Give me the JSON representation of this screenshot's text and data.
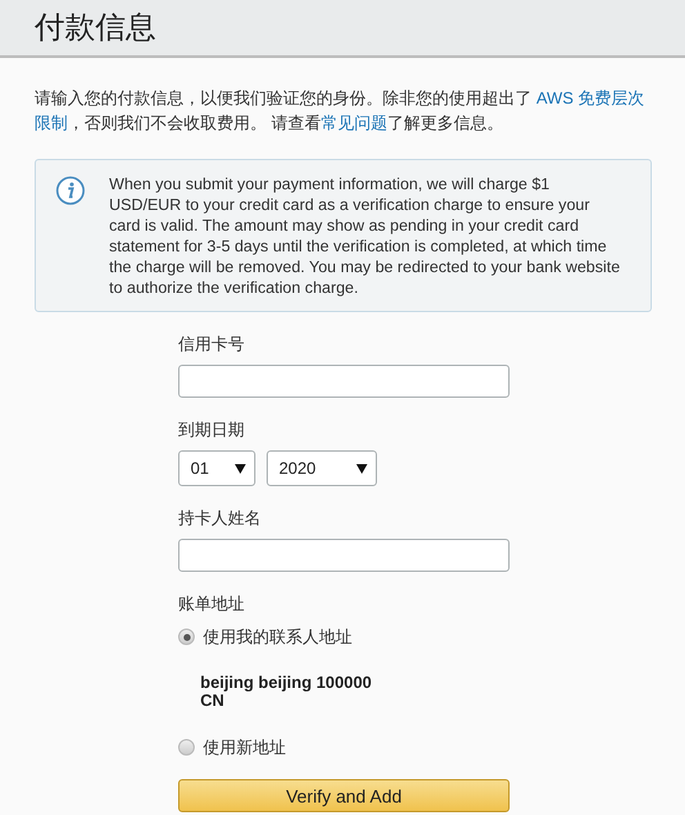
{
  "header": {
    "title": "付款信息"
  },
  "intro": [
    {
      "kind": "text",
      "text": "请输入您的付款信息，以便我们验证您的身份。除非您的使用超出了 "
    },
    {
      "kind": "link",
      "text": "AWS 免费层次"
    },
    {
      "kind": "link",
      "text": "限制"
    },
    {
      "kind": "text",
      "text": "，否则我们不会收取费用。 请查看"
    },
    {
      "kind": "link",
      "text": "常见问题"
    },
    {
      "kind": "text",
      "text": "了解更多信息。"
    }
  ],
  "info": {
    "text": "When you submit your payment information, we will charge $1 USD/EUR to your credit card as a verification charge to ensure your card is valid. The amount may show as pending in your credit card statement for 3-5 days until the verification is completed, at which time the charge will be removed. You may be redirected to your bank website to authorize the verification charge."
  },
  "form": {
    "card_number": {
      "label": "信用卡号"
    },
    "expiry": {
      "label": "到期日期",
      "month": "01",
      "year": "2020"
    },
    "cardholder": {
      "label": "持卡人姓名"
    },
    "billing": {
      "label": "账单地址",
      "options": [
        {
          "label": "使用我的联系人地址",
          "selected": true,
          "address": [
            "beijing beijing 100000",
            "CN"
          ]
        },
        {
          "label": "使用新地址",
          "selected": false
        }
      ]
    },
    "submit": "Verify and Add"
  }
}
